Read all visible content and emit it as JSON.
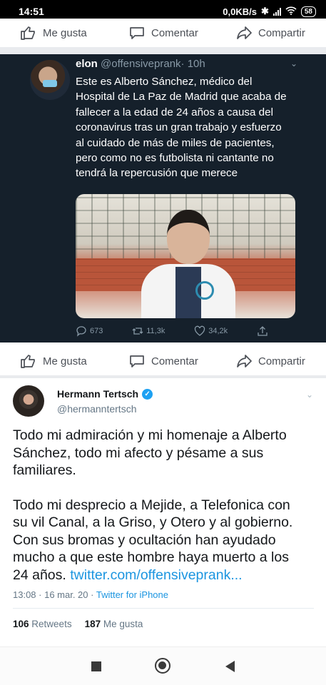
{
  "statusbar": {
    "time": "14:51",
    "network": "0,0KB/s",
    "battery": "58"
  },
  "fb_bar_top": {
    "like": "Me gusta",
    "comment": "Comentar",
    "share": "Compartir"
  },
  "fb_bar_mid": {
    "like": "Me gusta",
    "comment": "Comentar",
    "share": "Compartir"
  },
  "dark_tweet": {
    "name": "elon",
    "handle": "@offensiveprank",
    "time": "· 10h",
    "text": "Este es Alberto Sánchez, médico del Hospital de La Paz de Madrid que acaba de fallecer a la edad de 24 años a causa del coronavirus tras un gran trabajo y esfuerzo al cuidado de más de miles de pacientes, pero como no es futbolista ni cantante no tendrá la repercusión que merece",
    "replies": "673",
    "retweets": "11,3k",
    "likes": "34,2k"
  },
  "light_tweet": {
    "name": "Hermann Tertsch",
    "handle": "@hermanntertsch",
    "paragraph1": "Todo mi admiración y mi homenaje a Alberto Sánchez, todo mi afecto y pésame a sus familiares.",
    "paragraph2": "Todo mi desprecio a Mejide, a Telefonica con su vil Canal, a la Griso, y Otero y al gobierno. Con sus bromas y ocultación han ayudado mucho a que este hombre haya muerto a los 24 años.",
    "link": "twitter.com/offensiveprank...",
    "date": "13:08 · 16 mar. 20 · ",
    "app": "Twitter for iPhone",
    "retweets_count": "106",
    "retweets_label": "Retweets",
    "likes_count": "187",
    "likes_label": "Me gusta"
  },
  "colors": {
    "dark_bg": "#15202b",
    "link": "#1b95e0",
    "verified": "#1da1f2"
  }
}
